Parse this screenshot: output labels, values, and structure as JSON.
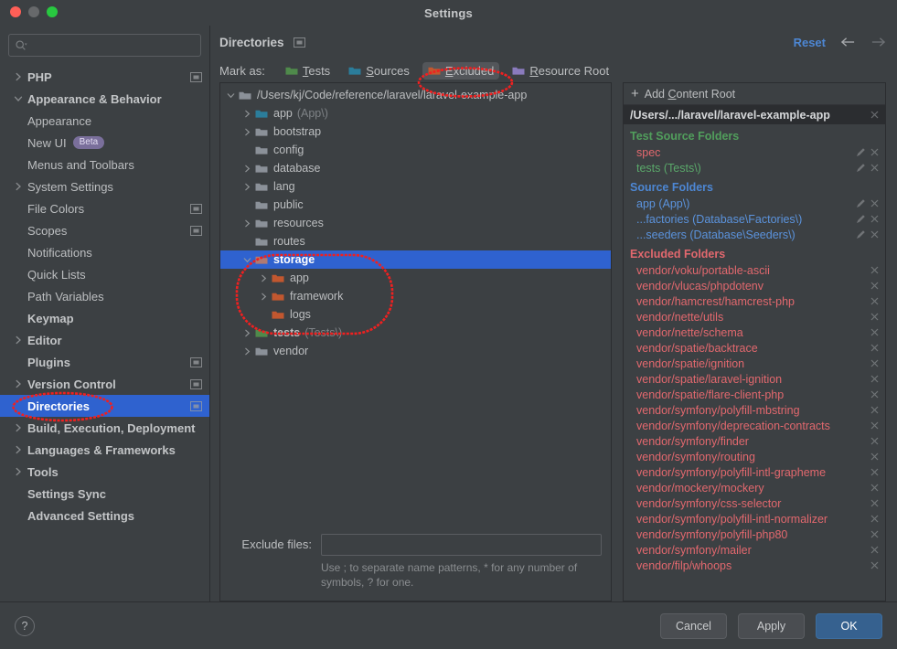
{
  "window": {
    "title": "Settings",
    "traffic_lights": [
      "close",
      "minimize",
      "maximize"
    ]
  },
  "sidebar": {
    "search": {
      "placeholder": "",
      "icon": "search-icon"
    },
    "items": [
      {
        "label": "PHP",
        "level": 0,
        "arrow": "right",
        "module_icon": true
      },
      {
        "label": "Appearance & Behavior",
        "level": 0,
        "arrow": "down",
        "module_icon": false
      },
      {
        "label": "Appearance",
        "level": 1,
        "arrow": "none",
        "module_icon": false
      },
      {
        "label": "New UI",
        "level": 1,
        "arrow": "none",
        "badge": "Beta",
        "module_icon": false
      },
      {
        "label": "Menus and Toolbars",
        "level": 1,
        "arrow": "none",
        "module_icon": false
      },
      {
        "label": "System Settings",
        "level": 1,
        "arrow": "right",
        "module_icon": false
      },
      {
        "label": "File Colors",
        "level": 1,
        "arrow": "none",
        "module_icon": true
      },
      {
        "label": "Scopes",
        "level": 1,
        "arrow": "none",
        "module_icon": true
      },
      {
        "label": "Notifications",
        "level": 1,
        "arrow": "none",
        "module_icon": false
      },
      {
        "label": "Quick Lists",
        "level": 1,
        "arrow": "none",
        "module_icon": false
      },
      {
        "label": "Path Variables",
        "level": 1,
        "arrow": "none",
        "module_icon": false
      },
      {
        "label": "Keymap",
        "level": 0,
        "arrow": "none",
        "module_icon": false
      },
      {
        "label": "Editor",
        "level": 0,
        "arrow": "right",
        "module_icon": false
      },
      {
        "label": "Plugins",
        "level": 0,
        "arrow": "none",
        "module_icon": true
      },
      {
        "label": "Version Control",
        "level": 0,
        "arrow": "right",
        "module_icon": true
      },
      {
        "label": "Directories",
        "level": 0,
        "arrow": "none",
        "module_icon": true,
        "selected": true
      },
      {
        "label": "Build, Execution, Deployment",
        "level": 0,
        "arrow": "right",
        "module_icon": false
      },
      {
        "label": "Languages & Frameworks",
        "level": 0,
        "arrow": "right",
        "module_icon": false
      },
      {
        "label": "Tools",
        "level": 0,
        "arrow": "right",
        "module_icon": false
      },
      {
        "label": "Settings Sync",
        "level": 0,
        "arrow": "none",
        "module_icon": false
      },
      {
        "label": "Advanced Settings",
        "level": 0,
        "arrow": "none",
        "module_icon": false
      }
    ]
  },
  "main": {
    "title": "Directories",
    "title_icon": "module-icon",
    "reset_label": "Reset",
    "back_icon": "arrow-left-icon",
    "forward_icon": "arrow-right-icon",
    "markas": {
      "label": "Mark as:",
      "buttons": [
        {
          "label": "Tests",
          "mnemonic": "T",
          "color": "#4f8a4b",
          "active": false
        },
        {
          "label": "Sources",
          "mnemonic": "S",
          "color": "#2b7d9b",
          "active": false
        },
        {
          "label": "Excluded",
          "mnemonic": "E",
          "color": "#c2572f",
          "active": true
        },
        {
          "label": "Resource Root",
          "mnemonic": "R",
          "color": "#8a7bbd",
          "active": false
        }
      ]
    },
    "tree": [
      {
        "name": "/Users/kj/Code/reference/laravel/laravel-example-app",
        "suffix": "",
        "indent": 0,
        "arrow": "down",
        "color": "#8b9199",
        "selected": false
      },
      {
        "name": "app",
        "suffix": "(App\\)",
        "indent": 1,
        "arrow": "right",
        "color": "#2b7d9b",
        "selected": false
      },
      {
        "name": "bootstrap",
        "suffix": "",
        "indent": 1,
        "arrow": "right",
        "color": "#8b9199",
        "selected": false
      },
      {
        "name": "config",
        "suffix": "",
        "indent": 1,
        "arrow": "none",
        "color": "#8b9199",
        "selected": false
      },
      {
        "name": "database",
        "suffix": "",
        "indent": 1,
        "arrow": "right",
        "color": "#8b9199",
        "selected": false
      },
      {
        "name": "lang",
        "suffix": "",
        "indent": 1,
        "arrow": "right",
        "color": "#8b9199",
        "selected": false
      },
      {
        "name": "public",
        "suffix": "",
        "indent": 1,
        "arrow": "none",
        "color": "#8b9199",
        "selected": false
      },
      {
        "name": "resources",
        "suffix": "",
        "indent": 1,
        "arrow": "right",
        "color": "#8b9199",
        "selected": false
      },
      {
        "name": "routes",
        "suffix": "",
        "indent": 1,
        "arrow": "none",
        "color": "#8b9199",
        "selected": false
      },
      {
        "name": "storage",
        "suffix": "",
        "indent": 1,
        "arrow": "down",
        "color": "#b07a72",
        "selected": true
      },
      {
        "name": "app",
        "suffix": "",
        "indent": 2,
        "arrow": "right",
        "color": "#c2572f",
        "selected": false
      },
      {
        "name": "framework",
        "suffix": "",
        "indent": 2,
        "arrow": "right",
        "color": "#c2572f",
        "selected": false
      },
      {
        "name": "logs",
        "suffix": "",
        "indent": 2,
        "arrow": "none",
        "color": "#c2572f",
        "selected": false
      },
      {
        "name": "tests",
        "suffix": "(Tests\\)",
        "indent": 1,
        "arrow": "right",
        "color": "#4f8a4b",
        "selected": false,
        "bold": true
      },
      {
        "name": "vendor",
        "suffix": "",
        "indent": 1,
        "arrow": "right",
        "color": "#8b9199",
        "selected": false
      }
    ],
    "exclude_files": {
      "label": "Exclude files:",
      "value": "",
      "placeholder": "",
      "hint": "Use ; to separate name patterns, * for any number of symbols, ? for one."
    }
  },
  "right_pane": {
    "add_content_root": {
      "label": "Add Content Root",
      "mnemonic": "C",
      "plus": "+"
    },
    "content_root": {
      "path": "/Users/.../laravel/laravel-example-app",
      "close_icon": "close-icon"
    },
    "groups": [
      {
        "title": "Test Source Folders",
        "kind": "test",
        "items": [
          {
            "label": "spec",
            "style": "testred",
            "edit": true,
            "remove": true
          },
          {
            "label": "tests (Tests\\)",
            "style": "test",
            "edit": true,
            "remove": true
          }
        ]
      },
      {
        "title": "Source Folders",
        "kind": "source",
        "items": [
          {
            "label": "app (App\\)",
            "style": "source",
            "edit": true,
            "remove": true
          },
          {
            "label": "...factories (Database\\Factories\\)",
            "style": "source",
            "edit": true,
            "remove": true
          },
          {
            "label": "...seeders (Database\\Seeders\\)",
            "style": "source",
            "edit": true,
            "remove": true
          }
        ]
      },
      {
        "title": "Excluded Folders",
        "kind": "excluded",
        "items": [
          {
            "label": "vendor/voku/portable-ascii",
            "style": "excl",
            "edit": false,
            "remove": true
          },
          {
            "label": "vendor/vlucas/phpdotenv",
            "style": "excl",
            "edit": false,
            "remove": true
          },
          {
            "label": "vendor/hamcrest/hamcrest-php",
            "style": "excl",
            "edit": false,
            "remove": true
          },
          {
            "label": "vendor/nette/utils",
            "style": "excl",
            "edit": false,
            "remove": true
          },
          {
            "label": "vendor/nette/schema",
            "style": "excl",
            "edit": false,
            "remove": true
          },
          {
            "label": "vendor/spatie/backtrace",
            "style": "excl",
            "edit": false,
            "remove": true
          },
          {
            "label": "vendor/spatie/ignition",
            "style": "excl",
            "edit": false,
            "remove": true
          },
          {
            "label": "vendor/spatie/laravel-ignition",
            "style": "excl",
            "edit": false,
            "remove": true
          },
          {
            "label": "vendor/spatie/flare-client-php",
            "style": "excl",
            "edit": false,
            "remove": true
          },
          {
            "label": "vendor/symfony/polyfill-mbstring",
            "style": "excl",
            "edit": false,
            "remove": true
          },
          {
            "label": "vendor/symfony/deprecation-contracts",
            "style": "excl",
            "edit": false,
            "remove": true
          },
          {
            "label": "vendor/symfony/finder",
            "style": "excl",
            "edit": false,
            "remove": true
          },
          {
            "label": "vendor/symfony/routing",
            "style": "excl",
            "edit": false,
            "remove": true
          },
          {
            "label": "vendor/symfony/polyfill-intl-grapheme",
            "style": "excl",
            "edit": false,
            "remove": true
          },
          {
            "label": "vendor/mockery/mockery",
            "style": "excl",
            "edit": false,
            "remove": true
          },
          {
            "label": "vendor/symfony/css-selector",
            "style": "excl",
            "edit": false,
            "remove": true
          },
          {
            "label": "vendor/symfony/polyfill-intl-normalizer",
            "style": "excl",
            "edit": false,
            "remove": true
          },
          {
            "label": "vendor/symfony/polyfill-php80",
            "style": "excl",
            "edit": false,
            "remove": true
          },
          {
            "label": "vendor/symfony/mailer",
            "style": "excl",
            "edit": false,
            "remove": true
          },
          {
            "label": "vendor/filp/whoops",
            "style": "excl",
            "edit": false,
            "remove": true
          }
        ]
      }
    ]
  },
  "footer": {
    "help": "?",
    "cancel": "Cancel",
    "apply": "Apply",
    "ok": "OK"
  },
  "annotations": {
    "color": "#f02020",
    "marks": [
      "excluded-button-circle",
      "storage-subtree-circle",
      "directories-sidebar-circle"
    ]
  }
}
